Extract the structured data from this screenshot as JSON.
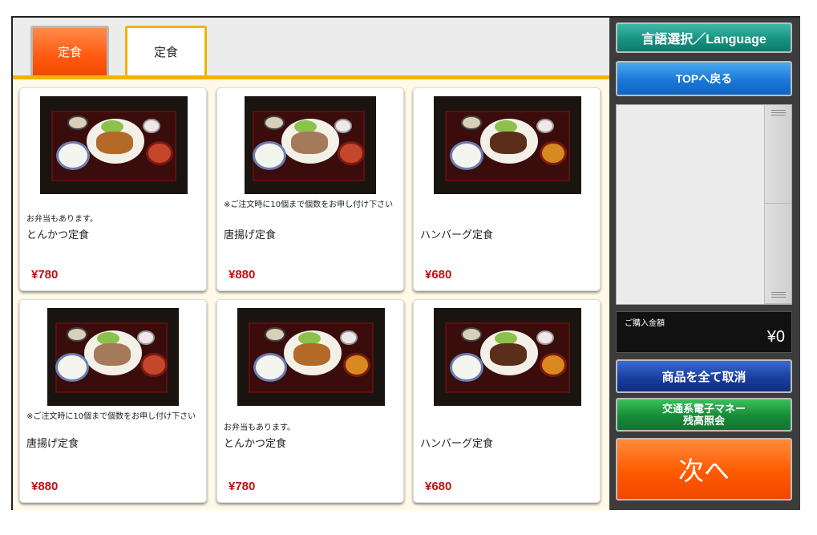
{
  "tabs": [
    {
      "label": "定食"
    },
    {
      "label": "定食"
    }
  ],
  "menu": [
    {
      "note": "お弁当もあります。",
      "name": "とんかつ定食",
      "price": "¥780",
      "type": "katsu"
    },
    {
      "note": "※ご注文時に10個まで個数をお申し付け下さい",
      "name": "唐揚げ定食",
      "price": "¥880",
      "type": "karaage"
    },
    {
      "note": "",
      "name": "ハンバーグ定食",
      "price": "¥680",
      "type": "hamburg"
    },
    {
      "note": "※ご注文時に10個まで個数をお申し付け下さい",
      "name": "唐揚げ定食",
      "price": "¥880",
      "type": "karaage"
    },
    {
      "note": "お弁当もあります。",
      "name": "とんかつ定食",
      "price": "¥780",
      "type": "katsu"
    },
    {
      "note": "",
      "name": "ハンバーグ定食",
      "price": "¥680",
      "type": "hamburg"
    }
  ],
  "side": {
    "language_label": "言語選択／Language",
    "top_label": "TOPへ戻る",
    "total_label": "ご購入金額",
    "total_value": "¥0",
    "cancel_label": "商品を全て取消",
    "ic_line1": "交通系電子マネー",
    "ic_line2": "残高照会",
    "next_label": "次へ"
  },
  "colors": {
    "accent": "#f0b400",
    "price": "#c01010",
    "next": "#ff5a00"
  }
}
